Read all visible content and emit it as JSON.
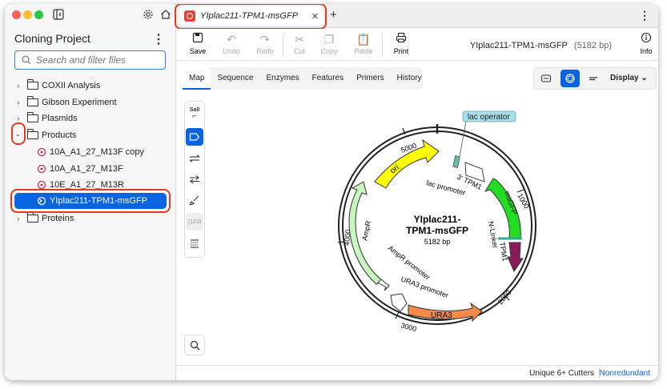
{
  "sidebar": {
    "title": "Cloning Project",
    "search_placeholder": "Search and filter files",
    "items": [
      {
        "label": "COXII Analysis"
      },
      {
        "label": "Gibson Experiment"
      },
      {
        "label": "Plasmids"
      },
      {
        "label": "Products"
      },
      {
        "label": "10A_A1_27_M13F copy"
      },
      {
        "label": "10A_A1_27_M13F"
      },
      {
        "label": "10E_A1_27_M13R"
      },
      {
        "label": "YIplac211-TPM1-msGFP"
      },
      {
        "label": "Proteins"
      }
    ]
  },
  "tab": {
    "title": "YIplac211-TPM1-msGFP",
    "new_tab": "+"
  },
  "toolbar": {
    "save": "Save",
    "undo": "Undo",
    "redo": "Redo",
    "cut": "Cut",
    "copy": "Copy",
    "paste": "Paste",
    "print": "Print",
    "info": "Info",
    "doc_name": "YIplac211-TPM1-msGFP",
    "doc_size": "(5182 bp)"
  },
  "subtabs": [
    "Map",
    "Sequence",
    "Enzymes",
    "Features",
    "Primers",
    "History"
  ],
  "view": {
    "display": "Display"
  },
  "tools": {
    "enzyme_label": "SalI",
    "count_label": "(123)"
  },
  "map": {
    "name_line1": "YIplac211-",
    "name_line2": "TPM1-msGFP",
    "length": "5182 bp",
    "ticks": [
      "1000",
      "2000",
      "3000",
      "4000",
      "5000"
    ],
    "features": [
      "lac operator",
      "3' TPM1",
      "lac promoter",
      "msGFP",
      "N-Linker",
      "TPM1",
      "ori",
      "AmpR",
      "AmpR promoter",
      "URA3 promoter",
      "URA3"
    ]
  },
  "status": {
    "cutters": "Unique 6+ Cutters",
    "mode": "Nonredundant"
  },
  "colors": {
    "accent": "#0a64e0",
    "highlight": "#e8391e",
    "ori": "#ffff00",
    "msgfp": "#22dd22",
    "ampr": "#c8f5c0",
    "ura3": "#f58a4a",
    "tpm1": "#8b1a5a"
  }
}
